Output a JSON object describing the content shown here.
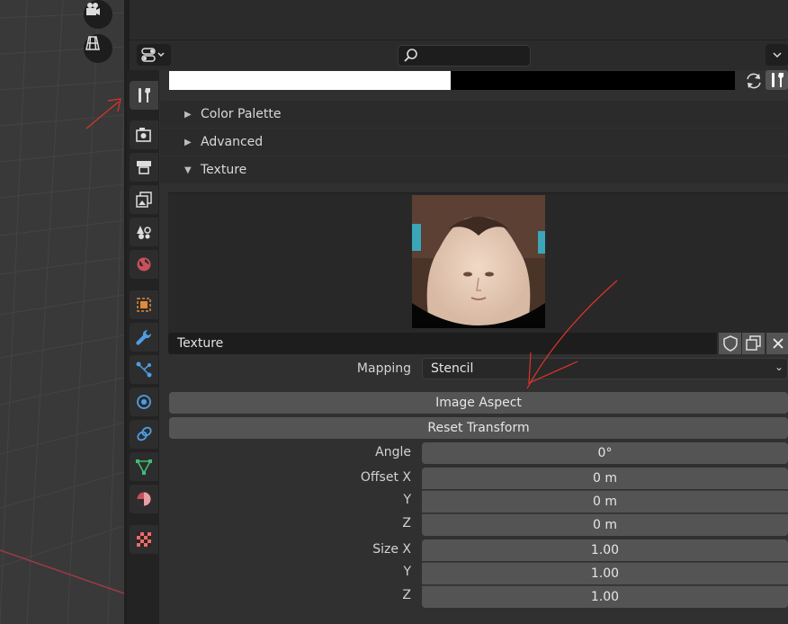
{
  "search": {
    "placeholder": ""
  },
  "sections": {
    "color_palette": "Color Palette",
    "advanced": "Advanced",
    "texture": "Texture"
  },
  "texture": {
    "name": "Texture",
    "mapping_label": "Mapping",
    "mapping_value": "Stencil",
    "image_aspect_button": "Image Aspect",
    "reset_transform_button": "Reset Transform"
  },
  "transform": {
    "angle": {
      "label": "Angle",
      "value": "0°"
    },
    "offset_x": {
      "label": "Offset X",
      "value": "0 m"
    },
    "offset_y": {
      "label": "Y",
      "value": "0 m"
    },
    "offset_z": {
      "label": "Z",
      "value": "0 m"
    },
    "size_x": {
      "label": "Size X",
      "value": "1.00"
    },
    "size_y": {
      "label": "Y",
      "value": "1.00"
    },
    "size_z": {
      "label": "Z",
      "value": "1.00"
    }
  },
  "tabs": [
    "tool-icon",
    "render-icon",
    "output-icon",
    "view-layer-icon",
    "scene-icon",
    "world-icon",
    "object-icon",
    "modifier-icon",
    "particles-icon",
    "physics-icon",
    "constraints-icon",
    "object-data-icon",
    "material-icon",
    "texture-icon"
  ],
  "colors": {
    "accent_orange": "#e3893b",
    "accent_blue": "#4d9ee6",
    "annotation_red": "#e0332b"
  }
}
